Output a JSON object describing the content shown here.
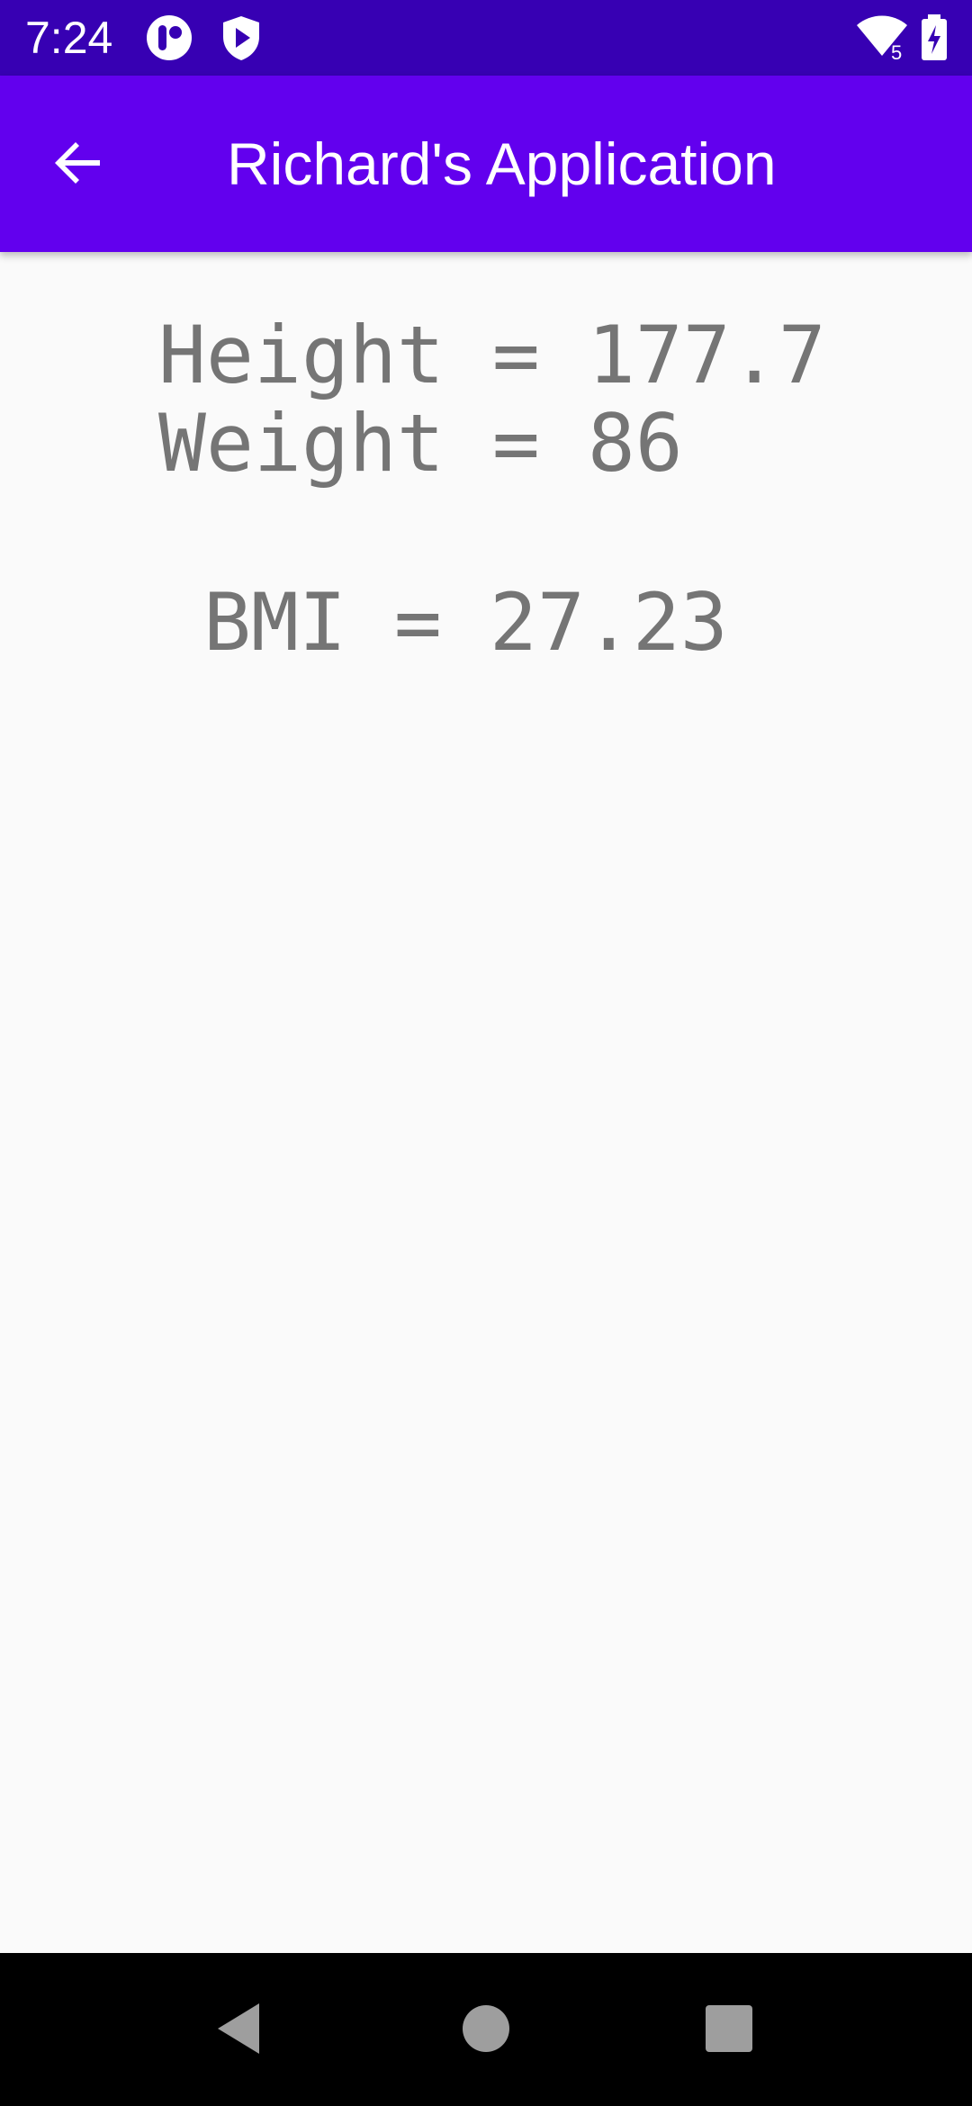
{
  "status_bar": {
    "time": "7:24",
    "icons": [
      "notification-circle-icon",
      "shield-play-icon",
      "wifi-5-icon",
      "battery-charging-icon"
    ],
    "wifi_badge": "5",
    "background": "#3700b3"
  },
  "app_bar": {
    "title": "Richard's Application",
    "back_icon": "arrow-back-icon",
    "background": "#6200ee"
  },
  "content": {
    "height_text": "Height = 177.7",
    "weight_text": "Weight = 86",
    "bmi_text": "BMI = 27.23",
    "text_color": "#757575"
  },
  "nav_bar": {
    "buttons": [
      "back-triangle-icon",
      "home-circle-icon",
      "recents-square-icon"
    ]
  }
}
